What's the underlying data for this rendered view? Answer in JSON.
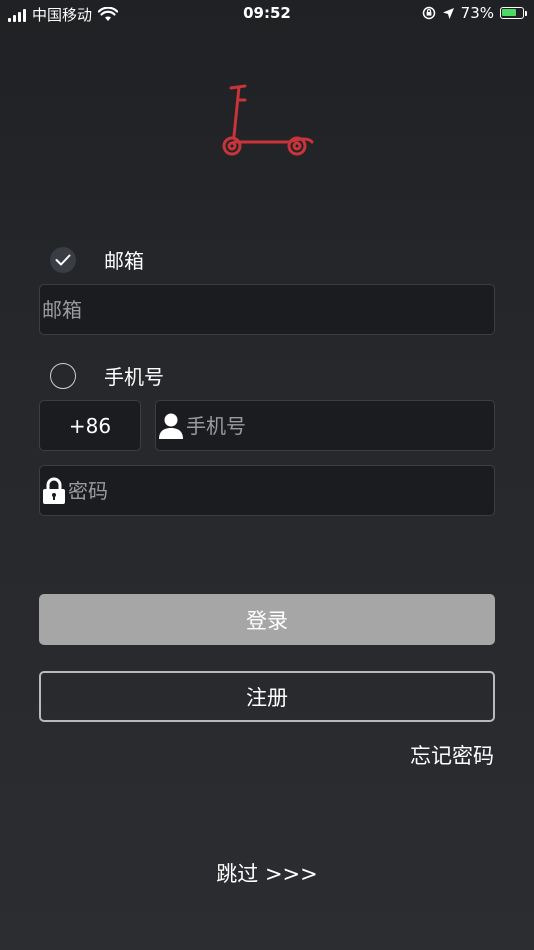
{
  "status_bar": {
    "carrier": "中国移动",
    "time": "09:52",
    "battery_percent": "73%",
    "battery_level": 0.73
  },
  "login_options": {
    "email_option_label": "邮箱",
    "phone_option_label": "手机号",
    "selected": "email"
  },
  "email_input": {
    "placeholder": "邮箱",
    "value": ""
  },
  "phone": {
    "country_code": "+86",
    "placeholder": "手机号",
    "value": ""
  },
  "password_input": {
    "placeholder": "密码",
    "value": ""
  },
  "buttons": {
    "login": "登录",
    "register": "注册",
    "forgot_password": "忘记密码",
    "skip": "跳过 >>>"
  },
  "colors": {
    "logo_red": "#c8343a",
    "login_button_bg": "#a6a6a6",
    "battery_green": "#4cd964"
  }
}
